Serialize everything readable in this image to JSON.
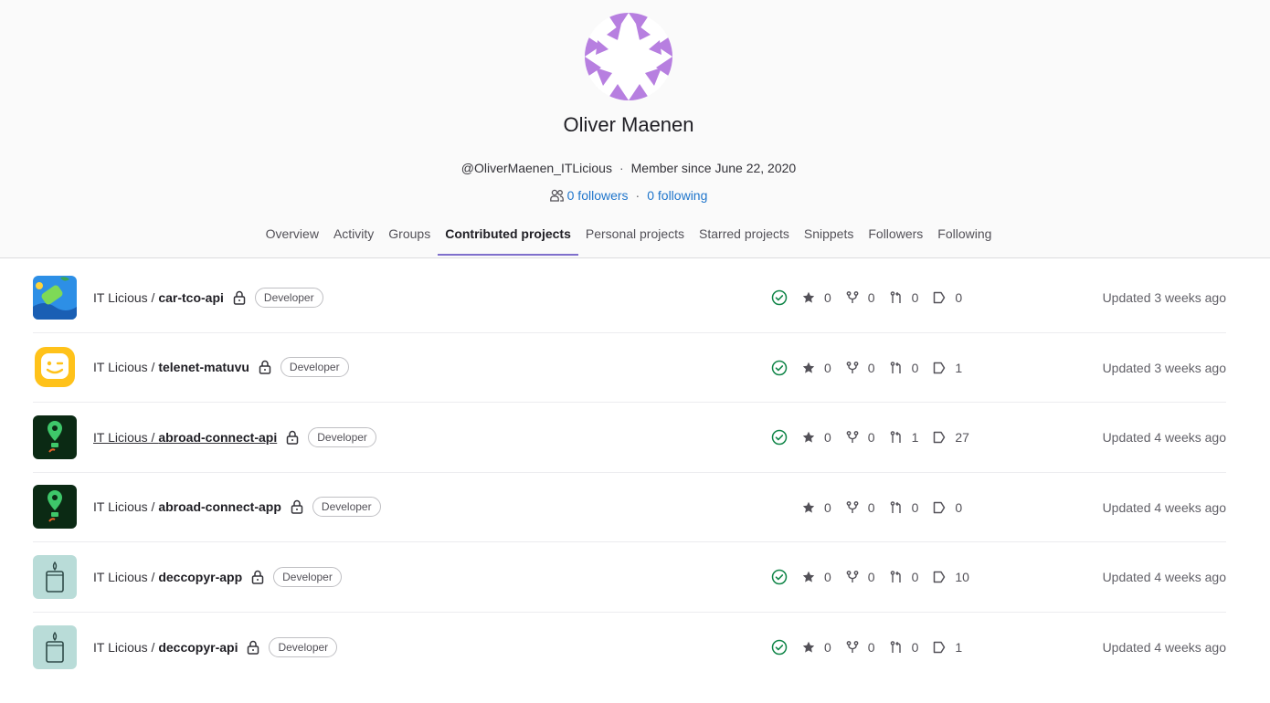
{
  "profile": {
    "name": "Oliver Maenen",
    "username": "@OliverMaenen_ITLicious",
    "member_since": "Member since June 22, 2020",
    "followers": "0 followers",
    "following": "0 following",
    "avatar_color": "#b77fe0"
  },
  "tabs": [
    {
      "label": "Overview",
      "active": false
    },
    {
      "label": "Activity",
      "active": false
    },
    {
      "label": "Groups",
      "active": false
    },
    {
      "label": "Contributed projects",
      "active": true
    },
    {
      "label": "Personal projects",
      "active": false
    },
    {
      "label": "Starred projects",
      "active": false
    },
    {
      "label": "Snippets",
      "active": false
    },
    {
      "label": "Followers",
      "active": false
    },
    {
      "label": "Following",
      "active": false
    }
  ],
  "projects": [
    {
      "namespace": "IT Licious / ",
      "name": "car-tco-api",
      "role": "Developer",
      "pipeline": "passed",
      "stars": "0",
      "forks": "0",
      "merge_requests": "0",
      "issues": "0",
      "updated": "Updated 3 weeks ago",
      "avatar": "car-icon"
    },
    {
      "namespace": "IT Licious / ",
      "name": "telenet-matuvu",
      "role": "Developer",
      "pipeline": "passed",
      "stars": "0",
      "forks": "0",
      "merge_requests": "0",
      "issues": "1",
      "updated": "Updated 3 weeks ago",
      "avatar": "smiley-icon"
    },
    {
      "namespace": "IT Licious / ",
      "name": "abroad-connect-api",
      "role": "Developer",
      "pipeline": "passed",
      "stars": "0",
      "forks": "0",
      "merge_requests": "1",
      "issues": "27",
      "updated": "Updated 4 weeks ago",
      "avatar": "location-pin-icon"
    },
    {
      "namespace": "IT Licious / ",
      "name": "abroad-connect-app",
      "role": "Developer",
      "pipeline": "",
      "stars": "0",
      "forks": "0",
      "merge_requests": "0",
      "issues": "0",
      "updated": "Updated 4 weeks ago",
      "avatar": "location-pin-icon"
    },
    {
      "namespace": "IT Licious / ",
      "name": "deccopyr-app",
      "role": "Developer",
      "pipeline": "passed",
      "stars": "0",
      "forks": "0",
      "merge_requests": "0",
      "issues": "10",
      "updated": "Updated 4 weeks ago",
      "avatar": "candle-icon"
    },
    {
      "namespace": "IT Licious / ",
      "name": "deccopyr-api",
      "role": "Developer",
      "pipeline": "passed",
      "stars": "0",
      "forks": "0",
      "merge_requests": "0",
      "issues": "1",
      "updated": "Updated 4 weeks ago",
      "avatar": "candle-icon"
    }
  ]
}
